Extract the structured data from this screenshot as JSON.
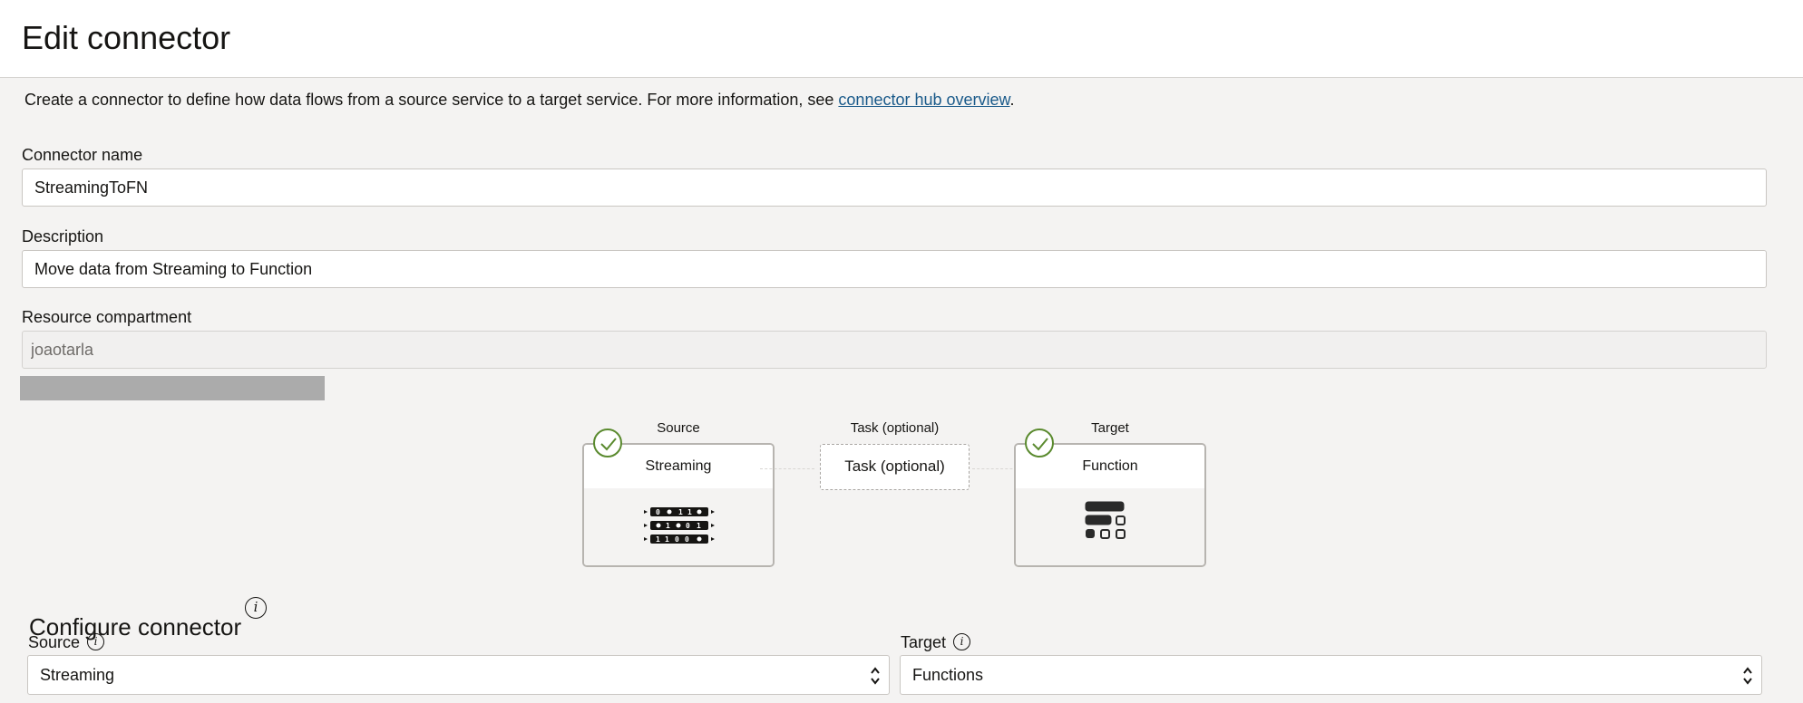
{
  "header": {
    "title": "Edit connector"
  },
  "intro": {
    "text": "Create a connector to define how data flows from a source service to a target service. For more information, see ",
    "link_text": "connector hub overview",
    "suffix": "."
  },
  "form": {
    "connector_name": {
      "label": "Connector name",
      "value": "StreamingToFN"
    },
    "description": {
      "label": "Description",
      "value": "Move data from Streaming to Function"
    },
    "compartment": {
      "label": "Resource compartment",
      "value": "joaotarla"
    }
  },
  "flow": {
    "source": {
      "caption": "Source",
      "title": "Streaming",
      "icon": "stream-icon",
      "complete": true
    },
    "task": {
      "caption": "Task (optional)",
      "label": "Task (optional)"
    },
    "target": {
      "caption": "Target",
      "title": "Function",
      "icon": "function-icon",
      "complete": true
    }
  },
  "configure": {
    "title": "Configure connector",
    "source": {
      "label": "Source",
      "selected": "Streaming"
    },
    "target": {
      "label": "Target",
      "selected": "Functions"
    }
  },
  "colors": {
    "check": "#5a8a2e",
    "link": "#1a5a8a",
    "page_bg": "#f4f3f2"
  }
}
